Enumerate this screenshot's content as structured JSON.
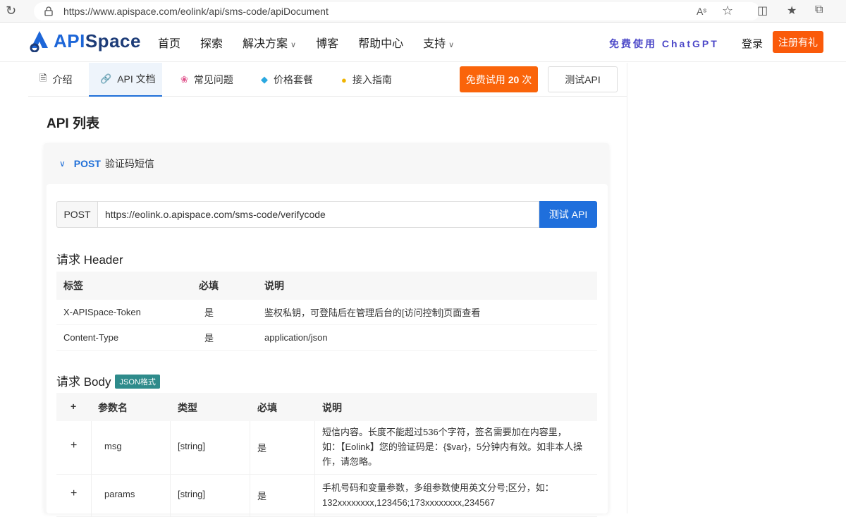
{
  "browser": {
    "url": "https://www.apispace.com/eolink/api/sms-code/apiDocument"
  },
  "header": {
    "logo_prefix": "API",
    "logo_suffix": "Space",
    "nav": [
      {
        "label": "首页",
        "dropdown": false
      },
      {
        "label": "探索",
        "dropdown": false
      },
      {
        "label": "解决方案",
        "dropdown": true
      },
      {
        "label": "博客",
        "dropdown": false
      },
      {
        "label": "帮助中心",
        "dropdown": false
      },
      {
        "label": "支持",
        "dropdown": true
      }
    ],
    "promo": "免费使用 ChatGPT",
    "login": "登录",
    "register": "注册有礼"
  },
  "tabs": [
    {
      "label": "介绍",
      "icon": "doc-icon"
    },
    {
      "label": "API 文档",
      "icon": "link-icon",
      "active": true
    },
    {
      "label": "常见问题",
      "icon": "flower-icon"
    },
    {
      "label": "价格套餐",
      "icon": "diamond-icon"
    },
    {
      "label": "接入指南",
      "icon": "bulb-icon"
    }
  ],
  "actions": {
    "trial_prefix": "免费试用",
    "trial_count": "20",
    "trial_suffix": "次",
    "test": "测试API"
  },
  "section_title": "API 列表",
  "api": {
    "method": "POST",
    "name": "验证码短信",
    "request_method": "POST",
    "url": "https://eolink.o.apispace.com/sms-code/verifycode",
    "test_button": "测试 API",
    "header_title": "请求 Header",
    "header_columns": [
      "标签",
      "必填",
      "说明"
    ],
    "header_rows": [
      [
        "X-APISpace-Token",
        "是",
        "鉴权私钥，可登陆后在管理后台的[访问控制]页面查看"
      ],
      [
        "Content-Type",
        "是",
        "application/json"
      ]
    ],
    "body_title": "请求 Body",
    "body_badge": "JSON格式",
    "body_columns": [
      "+",
      "参数名",
      "类型",
      "必填",
      "说明"
    ],
    "body_rows": [
      {
        "expand": "+",
        "name": "msg",
        "type": "[string]",
        "required": "是",
        "desc_lines": [
          "短信内容。长度不能超过536个字符，签名需要加在内容里，",
          "如：【Eolink】您的验证码是：{$var}，5分钟内有效。如非本人操",
          "作，请忽略。"
        ]
      },
      {
        "expand": "+",
        "name": "params",
        "type": "[string]",
        "required": "是",
        "desc_lines": [
          "手机号码和变量参数，多组参数使用英文分号;区分，如：",
          "132xxxxxxxx,123456;173xxxxxxxx,234567"
        ]
      }
    ]
  }
}
